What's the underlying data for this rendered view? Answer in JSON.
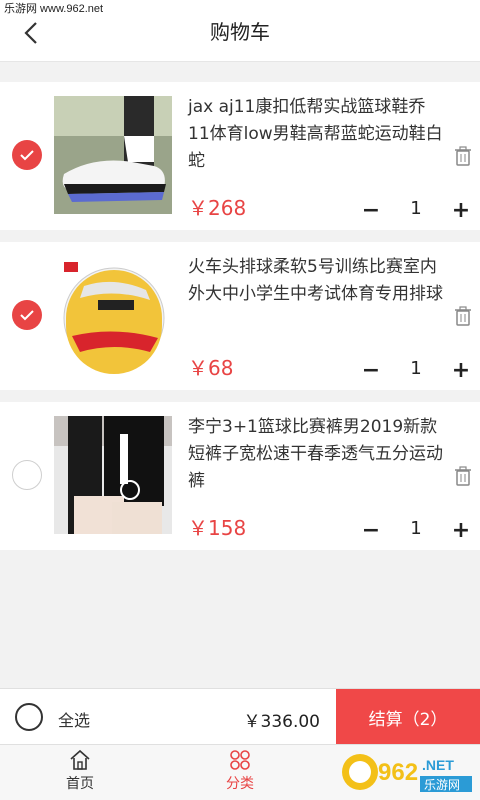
{
  "watermark_top": "乐游网 www.962.net",
  "header": {
    "title": "购物车"
  },
  "items": [
    {
      "name": "jax aj11康扣低帮实战篮球鞋乔11体育low男鞋高帮蓝蛇运动鞋白蛇",
      "price": "￥268",
      "qty": "1",
      "checked": true,
      "image": "sneaker"
    },
    {
      "name": "火车头排球柔软5号训练比赛室内外大中小学生中考试体育专用排球",
      "price": "￥68",
      "qty": "1",
      "checked": true,
      "image": "volleyball"
    },
    {
      "name": "李宁3+1篮球比赛裤男2019新款短裤子宽松速干春季透气五分运动裤",
      "price": "￥158",
      "qty": "1",
      "checked": false,
      "image": "shorts"
    }
  ],
  "controls": {
    "minus": "−",
    "plus": "+"
  },
  "bottom": {
    "select_all": "全选",
    "total": "￥336.00",
    "checkout": "结算（2）"
  },
  "tabs": [
    {
      "label": "首页"
    },
    {
      "label": "分类"
    }
  ],
  "watermark_logo": {
    "text": "962",
    "suffix": ".NET",
    "sub": "乐游网"
  },
  "colors": {
    "accent": "#e84444",
    "checkout_bg": "#f04848"
  }
}
